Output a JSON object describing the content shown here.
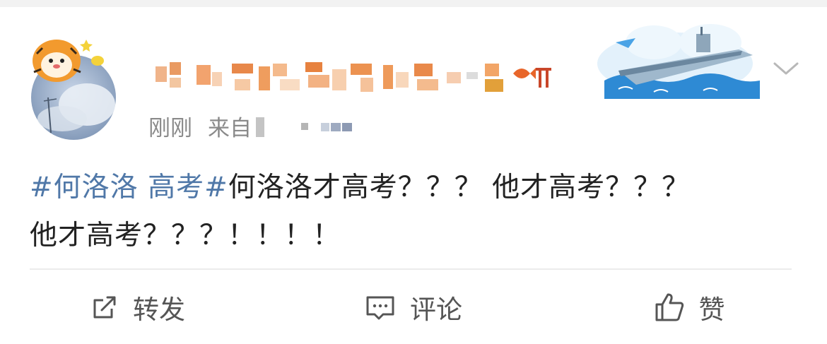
{
  "post": {
    "time": "刚刚",
    "source_prefix": "来自",
    "topic": "#何洛洛 高考#",
    "text": "何洛洛才高考？？？ 他才高考？？？ 他才高考？？？！！！！"
  },
  "actions": {
    "repost_label": "转发",
    "comment_label": "评论",
    "like_label": "赞"
  },
  "icons": {
    "repost": "repost-icon",
    "comment": "comment-icon",
    "like": "thumbs-up-icon",
    "chevron": "chevron-down-icon"
  },
  "colors": {
    "topic": "#5078a8",
    "meta": "#8a8a8a",
    "text": "#222222",
    "action": "#555555"
  }
}
